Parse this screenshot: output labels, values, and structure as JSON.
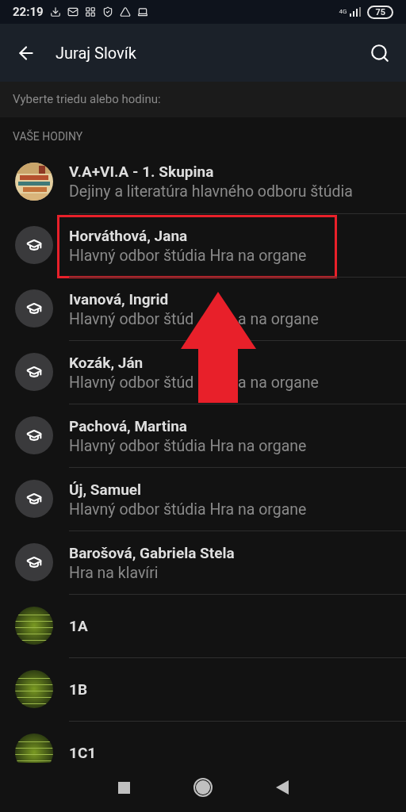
{
  "status_bar": {
    "time": "22:19",
    "network": "4G",
    "battery": "75"
  },
  "header": {
    "title": "Juraj Slovík"
  },
  "prompt": "Vyberte triedu alebo hodinu:",
  "section": {
    "title": "VAŠE HODINY"
  },
  "items": [
    {
      "title": "V.A+VI.A - 1. Skupina",
      "subtitle": [
        "Dejiny a literatúra hlavného odboru štúdia"
      ],
      "kind": "picture",
      "highlighted": false
    },
    {
      "title": "Horváthová, Jana",
      "subtitle": [
        "Hlavný odbor štúdia Hra na organe"
      ],
      "kind": "teacher",
      "highlighted": true
    },
    {
      "title": "Ivanová, Ingrid",
      "subtitle": [
        "Hlavný odbor štúd",
        "a na organe"
      ],
      "kind": "teacher",
      "highlighted": false
    },
    {
      "title": "Kozák, Ján",
      "subtitle": [
        "Hlavný odbor štúd",
        "a na organe"
      ],
      "kind": "teacher",
      "highlighted": false
    },
    {
      "title": "Pachová, Martina",
      "subtitle": [
        "Hlavný odbor štúdia Hra na organe"
      ],
      "kind": "teacher",
      "highlighted": false
    },
    {
      "title": "Új, Samuel",
      "subtitle": [
        "Hlavný odbor štúdia Hra na organe"
      ],
      "kind": "teacher",
      "highlighted": false
    },
    {
      "title": "Barošová, Gabriela Stela",
      "subtitle": [
        "Hra na klavíri"
      ],
      "kind": "teacher",
      "highlighted": false
    },
    {
      "title": "1A",
      "kind": "class",
      "highlighted": false
    },
    {
      "title": "1B",
      "kind": "class",
      "highlighted": false
    },
    {
      "title": "1C1",
      "kind": "class",
      "highlighted": false
    }
  ]
}
